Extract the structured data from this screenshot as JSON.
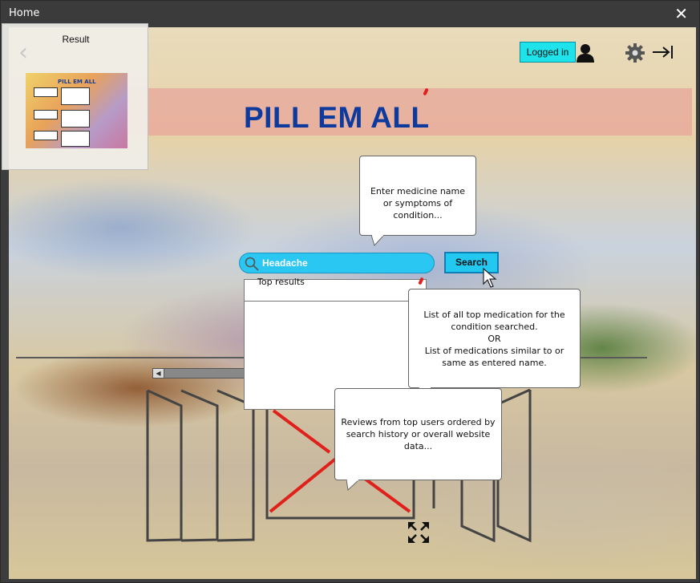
{
  "window": {
    "title": "Home",
    "close_icon": "close-icon"
  },
  "thumbnail_panel": {
    "label": "Result",
    "back_icon": "chevron-left-icon",
    "preview_title": "PILL EM ALL"
  },
  "header": {
    "app_title": "PILL EM ALL",
    "login_status": "Logged in",
    "user_icon": "user-icon",
    "settings_icon": "gear-icon",
    "logout_icon": "logout-arrow-icon"
  },
  "search": {
    "value": "Headache",
    "button_label": "Search",
    "results_header": "Top results"
  },
  "callouts": {
    "search_hint": "Enter medicine name or symptoms of condition...",
    "results_line1": "List of all top medication for the condition searched.",
    "results_line2": "OR",
    "results_line3": "List of medications similar to or same as entered name.",
    "reviews_hint": "Reviews from top users ordered by search history or overall website data..."
  },
  "colors": {
    "accent_cyan": "#29c7f2",
    "title_blue": "#0d3a9c",
    "banner_pink": "#e99696",
    "placeholder_red": "#e0201a"
  }
}
